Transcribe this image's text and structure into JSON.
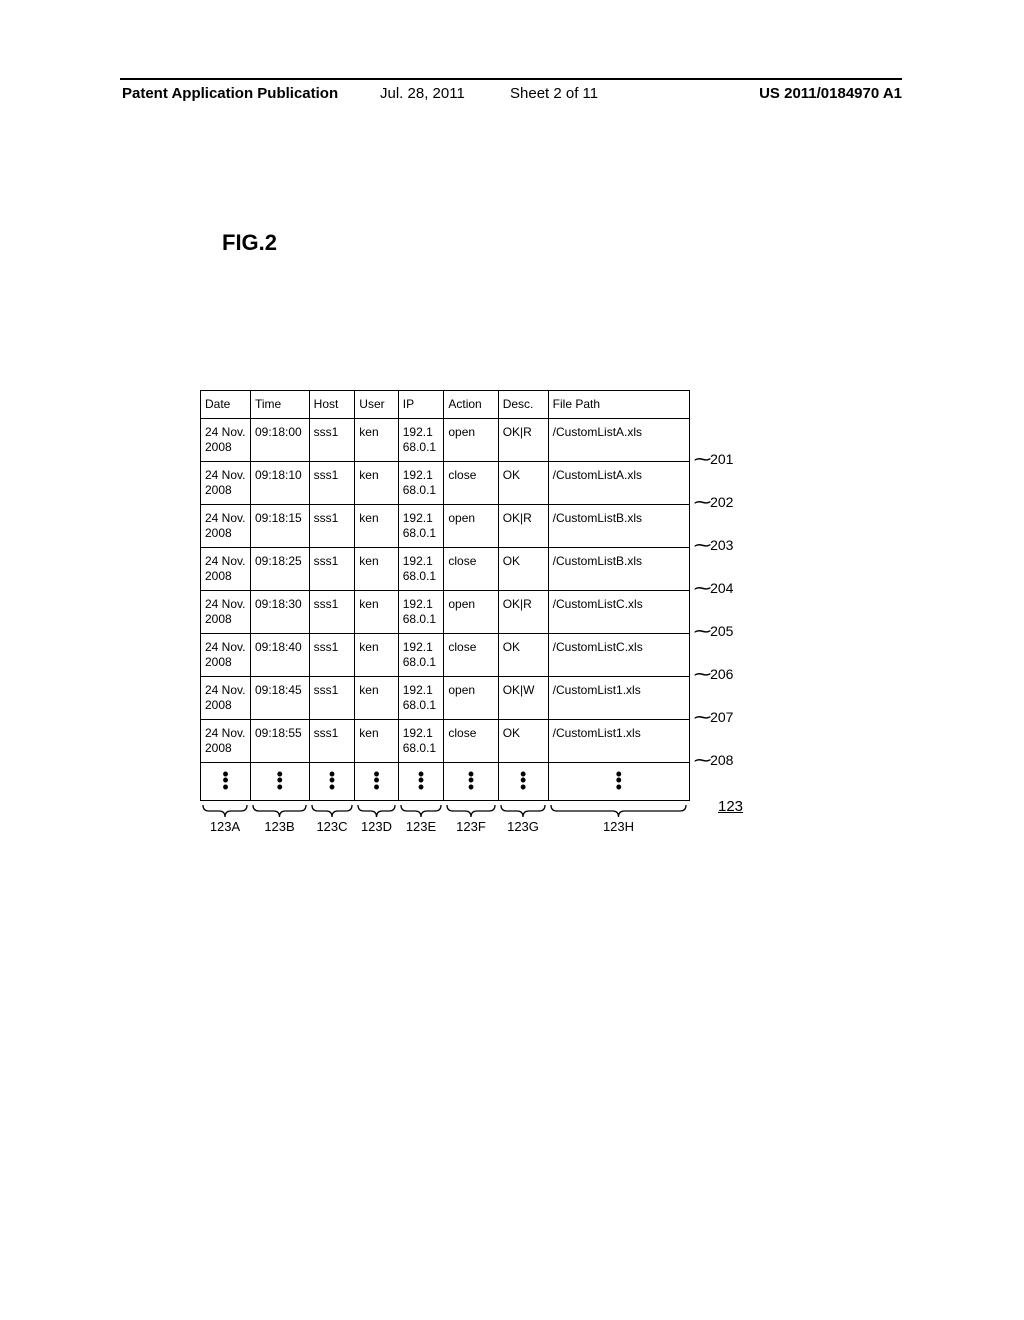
{
  "header": {
    "left": "Patent Application Publication",
    "date": "Jul. 28, 2011",
    "sheet": "Sheet 2 of 11",
    "right": "US 2011/0184970 A1"
  },
  "figure_label": "FIG.2",
  "columns": [
    "Date",
    "Time",
    "Host",
    "User",
    "IP",
    "Action",
    "Desc.",
    "File Path"
  ],
  "rows": [
    {
      "date": "24 Nov. 2008",
      "time": "09:18:00",
      "host": "sss1",
      "user": "ken",
      "ip": "192.168.0.1",
      "action": "open",
      "desc": "OK|R",
      "file": "/CustomListA.xls",
      "label": "201"
    },
    {
      "date": "24 Nov. 2008",
      "time": "09:18:10",
      "host": "sss1",
      "user": "ken",
      "ip": "192.168.0.1",
      "action": "close",
      "desc": "OK",
      "file": "/CustomListA.xls",
      "label": "202"
    },
    {
      "date": "24 Nov. 2008",
      "time": "09:18:15",
      "host": "sss1",
      "user": "ken",
      "ip": "192.168.0.1",
      "action": "open",
      "desc": "OK|R",
      "file": "/CustomListB.xls",
      "label": "203"
    },
    {
      "date": "24 Nov. 2008",
      "time": "09:18:25",
      "host": "sss1",
      "user": "ken",
      "ip": "192.168.0.1",
      "action": "close",
      "desc": "OK",
      "file": "/CustomListB.xls",
      "label": "204"
    },
    {
      "date": "24 Nov. 2008",
      "time": "09:18:30",
      "host": "sss1",
      "user": "ken",
      "ip": "192.168.0.1",
      "action": "open",
      "desc": "OK|R",
      "file": "/CustomListC.xls",
      "label": "205"
    },
    {
      "date": "24 Nov. 2008",
      "time": "09:18:40",
      "host": "sss1",
      "user": "ken",
      "ip": "192.168.0.1",
      "action": "close",
      "desc": "OK",
      "file": "/CustomListC.xls",
      "label": "206"
    },
    {
      "date": "24 Nov. 2008",
      "time": "09:18:45",
      "host": "sss1",
      "user": "ken",
      "ip": "192.168.0.1",
      "action": "open",
      "desc": "OK|W",
      "file": "/CustomList1.xls",
      "label": "207"
    },
    {
      "date": "24 Nov. 2008",
      "time": "09:18:55",
      "host": "sss1",
      "user": "ken",
      "ip": "192.168.0.1",
      "action": "close",
      "desc": "OK",
      "file": "/CustomList1.xls",
      "label": "208"
    }
  ],
  "col_labels": [
    "123A",
    "123B",
    "123C",
    "123D",
    "123E",
    "123F",
    "123G",
    "123H"
  ],
  "table_ref": "123"
}
